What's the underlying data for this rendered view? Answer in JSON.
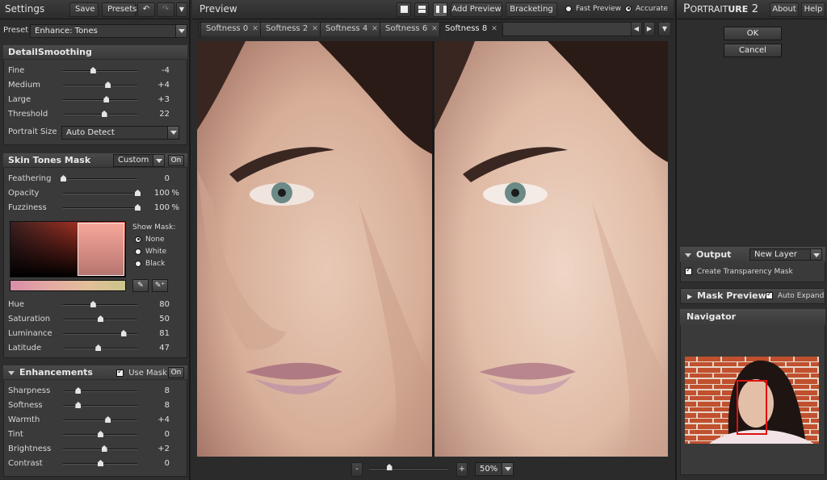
{
  "app": {
    "brand_prefix": "P",
    "brand_mid": "ORTRAIT",
    "brand_bold": "URE",
    "brand_num": "2",
    "about": "About",
    "help": "Help"
  },
  "settings_bar": {
    "title": "Settings",
    "save": "Save",
    "presets": "Presets"
  },
  "preset": {
    "label": "Preset",
    "value": "Enhance: Tones"
  },
  "detail_smoothing": {
    "title": "DetailSmoothing",
    "sliders": [
      {
        "label": "Fine",
        "value": "-4",
        "pos": 0.4
      },
      {
        "label": "Medium",
        "value": "+4",
        "pos": 0.6
      },
      {
        "label": "Large",
        "value": "+3",
        "pos": 0.58
      },
      {
        "label": "Threshold",
        "value": "22",
        "pos": 0.55
      }
    ],
    "portrait_size_label": "Portrait Size",
    "portrait_size_value": "Auto Detect"
  },
  "skin_tones": {
    "title": "Skin Tones Mask",
    "mode": "Custom",
    "on": "On",
    "sliders": [
      {
        "label": "Feathering",
        "value": "0",
        "unit": "",
        "pos": 0.0
      },
      {
        "label": "Opacity",
        "value": "100",
        "unit": "%",
        "pos": 1.0
      },
      {
        "label": "Fuzziness",
        "value": "100",
        "unit": "%",
        "pos": 1.0
      }
    ],
    "show_mask_label": "Show Mask:",
    "mask_options": [
      "None",
      "White",
      "Black"
    ],
    "mask_selected": "None",
    "color_sliders": [
      {
        "label": "Hue",
        "value": "80",
        "pos": 0.4
      },
      {
        "label": "Saturation",
        "value": "50",
        "pos": 0.5
      },
      {
        "label": "Luminance",
        "value": "81",
        "pos": 0.81
      },
      {
        "label": "Latitude",
        "value": "47",
        "pos": 0.47
      }
    ]
  },
  "enhancements": {
    "title": "Enhancements",
    "use_mask": "Use Mask",
    "on": "On",
    "sliders": [
      {
        "label": "Sharpness",
        "value": "8",
        "pos": 0.2
      },
      {
        "label": "Softness",
        "value": "8",
        "pos": 0.2
      },
      {
        "label": "Warmth",
        "value": "+4",
        "pos": 0.6
      },
      {
        "label": "Tint",
        "value": "0",
        "pos": 0.5
      },
      {
        "label": "Brightness",
        "value": "+2",
        "pos": 0.55
      },
      {
        "label": "Contrast",
        "value": "0",
        "pos": 0.5
      }
    ]
  },
  "preview": {
    "title": "Preview",
    "add_preview": "Add Preview",
    "bracketing": "Bracketing",
    "fast_preview": "Fast Preview",
    "accurate": "Accurate",
    "tabs": [
      "Softness 0",
      "Softness 2",
      "Softness 4",
      "Softness 6",
      "Softness 8"
    ],
    "active_tab": "Softness 8",
    "zoom": "50%",
    "zoom_pos": 0.25
  },
  "right_panel": {
    "ok": "OK",
    "cancel": "Cancel",
    "output_label": "Output",
    "output_value": "New Layer",
    "create_mask": "Create Transparency Mask",
    "mask_preview": "Mask Preview",
    "auto_expand": "Auto Expand",
    "navigator": "Navigator"
  },
  "colors": {
    "bg": "#2b2b2b",
    "panel": "#3a3a3a",
    "nav_box": "#e01010",
    "brick": "#c0502e"
  }
}
